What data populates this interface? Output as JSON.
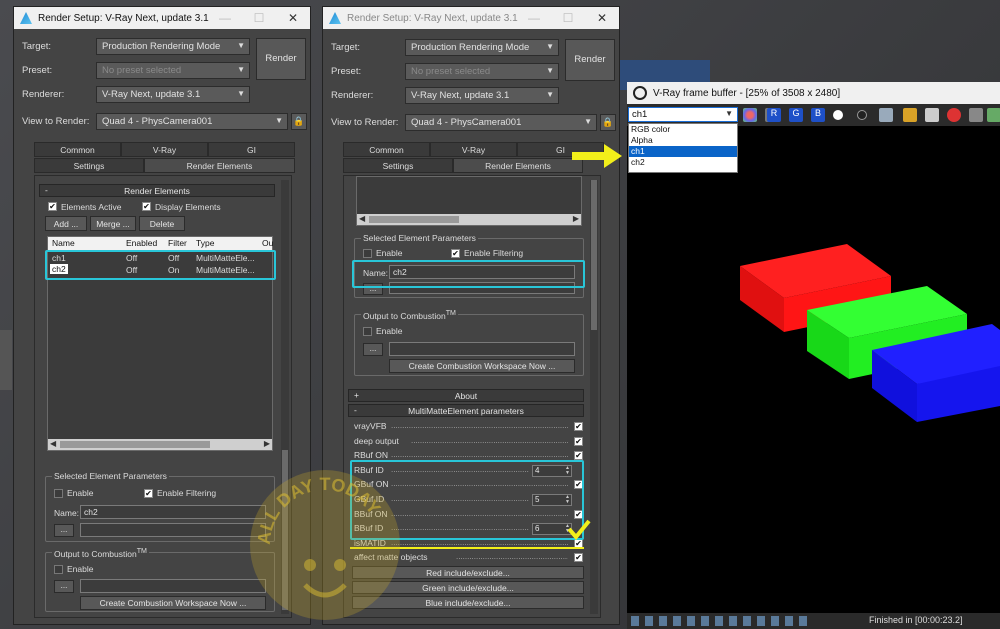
{
  "win1": {
    "title": "Render Setup: V-Ray Next, update 3.1",
    "target_label": "Target:",
    "target_value": "Production Rendering Mode",
    "preset_label": "Preset:",
    "preset_value": "No preset selected",
    "renderer_label": "Renderer:",
    "renderer_value": "V-Ray Next, update 3.1",
    "view_label": "View to Render:",
    "view_value": "Quad 4 - PhysCamera001",
    "render_button": "Render",
    "tabs_top": [
      "Common",
      "V-Ray",
      "GI"
    ],
    "tabs_bottom": [
      "Settings",
      "Render Elements"
    ],
    "rollout_title": "Render Elements",
    "elements_active": "Elements Active",
    "display_elements": "Display Elements",
    "add_btn": "Add ...",
    "merge_btn": "Merge ...",
    "delete_btn": "Delete",
    "columns": [
      "Name",
      "Enabled",
      "Filter",
      "Type",
      "Ou"
    ],
    "rows": [
      {
        "name": "ch1",
        "enabled": "Off",
        "filter": "Off",
        "type": "MultiMatteEle..."
      },
      {
        "name": "ch2",
        "enabled": "Off",
        "filter": "On",
        "type": "MultiMatteEle..."
      }
    ],
    "sel_group": "Selected Element Parameters",
    "enable": "Enable",
    "enable_filtering": "Enable Filtering",
    "name_label": "Name:",
    "name_value": "ch2",
    "browse": "...",
    "comb_group": "Output to Combustion",
    "tm": "TM",
    "create_comb": "Create Combustion Workspace Now ..."
  },
  "win2": {
    "title": "Render Setup: V-Ray Next, update 3.1",
    "target_label": "Target:",
    "target_value": "Production Rendering Mode",
    "preset_label": "Preset:",
    "preset_value": "No preset selected",
    "renderer_label": "Renderer:",
    "renderer_value": "V-Ray Next, update 3.1",
    "view_label": "View to Render:",
    "view_value": "Quad 4 - PhysCamera001",
    "render_button": "Render",
    "tabs_top": [
      "Common",
      "V-Ray",
      "GI"
    ],
    "tabs_bottom": [
      "Settings",
      "Render Elements"
    ],
    "sel_group": "Selected Element Parameters",
    "enable": "Enable",
    "enable_filtering": "Enable Filtering",
    "name_label": "Name:",
    "name_value": "ch2",
    "browse": "...",
    "comb_group": "Output to Combustion",
    "tm": "TM",
    "create_comb": "Create Combustion Workspace Now ...",
    "about": "About",
    "mm_title": "MultiMatteElement parameters",
    "params": [
      {
        "label": "vrayVFB",
        "type": "check"
      },
      {
        "label": "deep output",
        "type": "check"
      },
      {
        "label": "RBuf ON",
        "type": "check"
      },
      {
        "label": "RBuf ID",
        "type": "spin",
        "value": "4"
      },
      {
        "label": "GBuf ON",
        "type": "check"
      },
      {
        "label": "GBuf ID",
        "type": "spin",
        "value": "5"
      },
      {
        "label": "BBuf ON",
        "type": "check"
      },
      {
        "label": "BBuf ID",
        "type": "spin",
        "value": "6"
      },
      {
        "label": "isMATID",
        "type": "check"
      },
      {
        "label": "affect matte objects",
        "type": "check"
      }
    ],
    "red_btn": "Red include/exclude...",
    "green_btn": "Green include/exclude...",
    "blue_btn": "Blue include/exclude..."
  },
  "fb": {
    "title": "V-Ray frame buffer - [25% of 3508 x 2480]",
    "channel": "ch1",
    "channel_options": [
      "RGB color",
      "Alpha",
      "ch1",
      "ch2"
    ],
    "status": "Finished in [00:00:23.2]",
    "rgb": [
      "R",
      "G",
      "B"
    ]
  },
  "watermark_text": "ALL DAY TODAY",
  "colors": {
    "highlight": "#29c6d8",
    "arrow": "#f2ef1a",
    "selected": "#0a64c8"
  }
}
